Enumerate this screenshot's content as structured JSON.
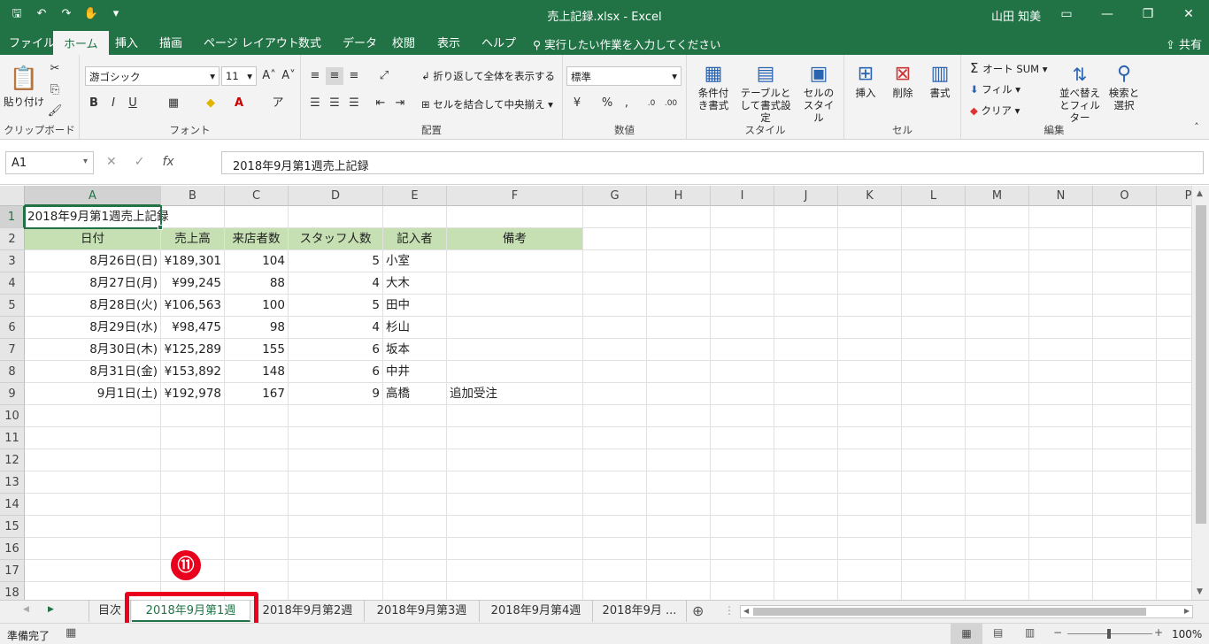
{
  "title_bar": {
    "document": "売上記録.xlsx  -  Excel",
    "user": "山田 知美"
  },
  "ribbon_tabs": [
    "ファイル",
    "ホーム",
    "挿入",
    "描画",
    "ページ レイアウト",
    "数式",
    "データ",
    "校閲",
    "表示",
    "ヘルプ"
  ],
  "tell_me": "実行したい作業を入力してください",
  "share": "共有",
  "ribbon": {
    "clipboard": {
      "paste": "貼り付け",
      "label": "クリップボード"
    },
    "font": {
      "name": "游ゴシック",
      "size": "11",
      "label": "フォント"
    },
    "alignment": {
      "wrap": "折り返して全体を表示する",
      "merge": "セルを結合して中央揃え",
      "label": "配置"
    },
    "number": {
      "format": "標準",
      "label": "数値"
    },
    "styles": {
      "conditional": "条件付き書式",
      "table": "テーブルとして書式設定",
      "cell": "セルのスタイル",
      "label": "スタイル"
    },
    "cells": {
      "insert": "挿入",
      "delete": "削除",
      "format": "書式",
      "label": "セル"
    },
    "editing": {
      "autosum": "オート SUM",
      "fill": "フィル",
      "clear": "クリア",
      "sort": "並べ替えとフィルター",
      "find": "検索と選択",
      "label": "編集"
    }
  },
  "formula_bar": {
    "name_box": "A1",
    "content": "2018年9月第1週売上記録"
  },
  "columns": [
    "A",
    "B",
    "C",
    "D",
    "E",
    "F",
    "G",
    "H",
    "I",
    "J",
    "K",
    "L",
    "M",
    "N",
    "O",
    "P"
  ],
  "rows": [
    "1",
    "2",
    "3",
    "4",
    "5",
    "6",
    "7",
    "8",
    "9",
    "10",
    "11",
    "12",
    "13",
    "14",
    "15",
    "16",
    "17",
    "18"
  ],
  "sheet": {
    "title": "2018年9月第1週売上記録",
    "headers": [
      "日付",
      "売上高",
      "来店者数",
      "スタッフ人数",
      "記入者",
      "備考"
    ],
    "records": [
      [
        "8月26日(日)",
        "¥189,301",
        "104",
        "5",
        "小室",
        ""
      ],
      [
        "8月27日(月)",
        "¥99,245",
        "88",
        "4",
        "大木",
        ""
      ],
      [
        "8月28日(火)",
        "¥106,563",
        "100",
        "5",
        "田中",
        ""
      ],
      [
        "8月29日(水)",
        "¥98,475",
        "98",
        "4",
        "杉山",
        ""
      ],
      [
        "8月30日(木)",
        "¥125,289",
        "155",
        "6",
        "坂本",
        ""
      ],
      [
        "8月31日(金)",
        "¥153,892",
        "148",
        "6",
        "中井",
        ""
      ],
      [
        "9月1日(土)",
        "¥192,978",
        "167",
        "9",
        "高橋",
        "追加受注"
      ]
    ]
  },
  "sheet_tabs": [
    "目次",
    "2018年9月第1週",
    "2018年9月第2週",
    "2018年9月第3週",
    "2018年9月第4週",
    "2018年9月 ..."
  ],
  "annotation": {
    "step": "⑪"
  },
  "status": {
    "ready": "準備完了",
    "zoom": "100%"
  }
}
